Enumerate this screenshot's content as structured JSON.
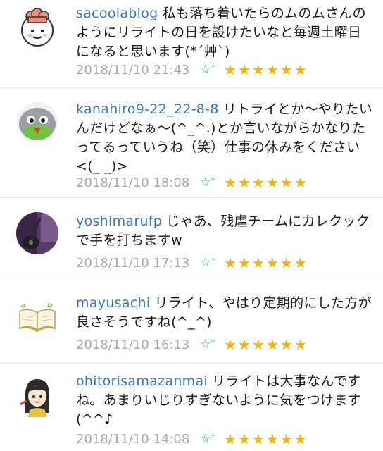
{
  "comments": [
    {
      "user": "sacoolablog",
      "text": "私も落ち着いたらのムのムさんのようにリライトの日を設けたいなと毎週土曜日になると思います(*´艸`)",
      "date": "2018/11/10 21:43",
      "stars": 6,
      "avatar_icon": "chef-avatar-icon"
    },
    {
      "user": "kanahiro9-22_22-8-8",
      "text": "リトライとか〜やりたいんだけどなぁ〜(^_^.)とか言いながらかなりたってるっていうね（笑）仕事の休みをください<(_ _)>",
      "date": "2018/11/10 18:08",
      "stars": 6,
      "avatar_icon": "blob-character-avatar-icon"
    },
    {
      "user": "yoshimarufp",
      "text": "じゃあ、残虐チームにカレクックで手を打ちますw",
      "date": "2018/11/10 17:13",
      "stars": 6,
      "avatar_icon": "guitar-photo-avatar-icon"
    },
    {
      "user": "mayusachi",
      "text": "リライト、やはり定期的にした方が良さそうですね(^_^)",
      "date": "2018/11/10 16:13",
      "stars": 6,
      "avatar_icon": "open-book-avatar-icon"
    },
    {
      "user": "ohitorisamazanmai",
      "text": "リライトは大事なんですね。あまりいじりすぎないように気をつけます(^^♪",
      "date": "2018/11/10 14:08",
      "stars": 6,
      "avatar_icon": "girl-avatar-icon"
    }
  ],
  "add_star_symbol": "☆",
  "add_star_plus": "+",
  "star_symbol": "★",
  "colors": {
    "username": "#3c79b8",
    "date": "#a8a8a8",
    "star": "#f5b400",
    "add_star": "#3c8fd1"
  }
}
